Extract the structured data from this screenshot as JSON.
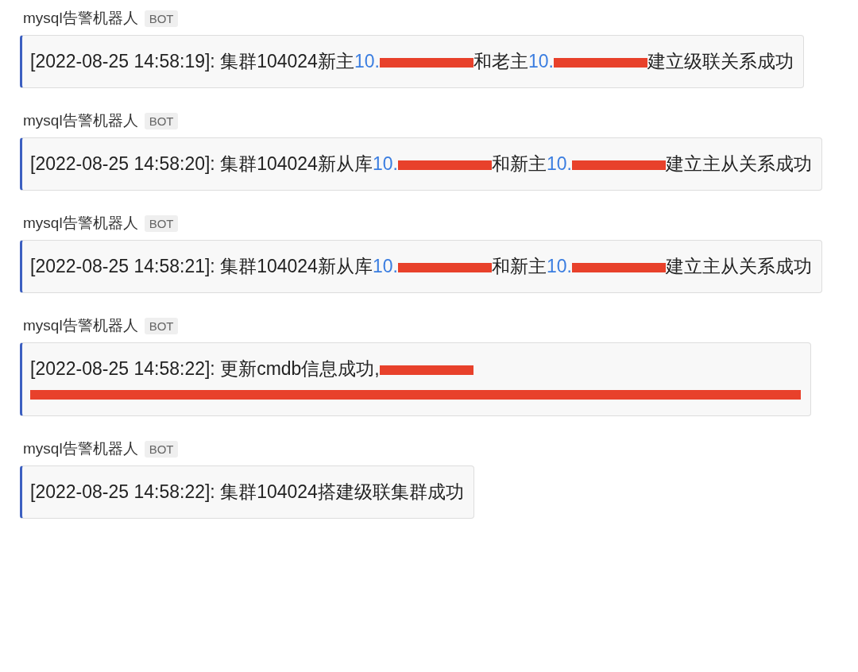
{
  "messages": [
    {
      "sender": "mysql告警机器人",
      "badge": "BOT",
      "segments": [
        {
          "kind": "text",
          "text": "[2022-08-25 14:58:19]: 集群104024新主"
        },
        {
          "kind": "link",
          "text": "10."
        },
        {
          "kind": "redacted"
        },
        {
          "kind": "text",
          "text": "和老主"
        },
        {
          "kind": "link",
          "text": "10."
        },
        {
          "kind": "redacted"
        },
        {
          "kind": "text",
          "text": "建立级联关系成功"
        }
      ]
    },
    {
      "sender": "mysql告警机器人",
      "badge": "BOT",
      "segments": [
        {
          "kind": "text",
          "text": "[2022-08-25 14:58:20]: 集群104024新从库"
        },
        {
          "kind": "link",
          "text": "10."
        },
        {
          "kind": "redacted"
        },
        {
          "kind": "text",
          "text": "和新主"
        },
        {
          "kind": "link",
          "text": "10."
        },
        {
          "kind": "redacted"
        },
        {
          "kind": "text",
          "text": "建立主从关系成功"
        }
      ]
    },
    {
      "sender": "mysql告警机器人",
      "badge": "BOT",
      "segments": [
        {
          "kind": "text",
          "text": "[2022-08-25 14:58:21]: 集群104024新从库"
        },
        {
          "kind": "link",
          "text": "10."
        },
        {
          "kind": "redacted"
        },
        {
          "kind": "text",
          "text": "和新主"
        },
        {
          "kind": "link",
          "text": "10."
        },
        {
          "kind": "redacted"
        },
        {
          "kind": "text",
          "text": "建立主从关系成功"
        }
      ]
    },
    {
      "sender": "mysql告警机器人",
      "badge": "BOT",
      "segments": [
        {
          "kind": "text",
          "text": "[2022-08-25 14:58:22]: 更新cmdb信息成功,"
        },
        {
          "kind": "redacted"
        },
        {
          "kind": "redacted_line"
        }
      ]
    },
    {
      "sender": "mysql告警机器人",
      "badge": "BOT",
      "segments": [
        {
          "kind": "text",
          "text": "[2022-08-25 14:58:22]: 集群104024搭建级联集群成功"
        }
      ]
    }
  ]
}
